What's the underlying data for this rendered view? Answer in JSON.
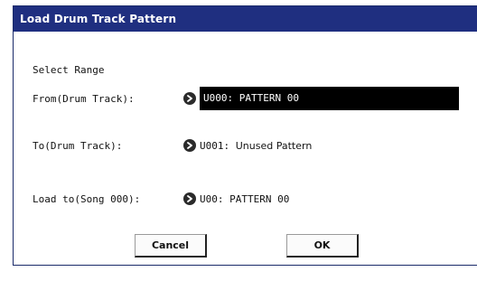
{
  "dialog": {
    "title": "Load Drum Track Pattern",
    "section_label": "Select Range",
    "from": {
      "label": "From(Drum Track):",
      "value": "U000: PATTERN 00",
      "arrow_icon": "right-arrow-icon"
    },
    "to": {
      "label": "To(Drum Track):",
      "value_code": "U001:",
      "value_name": "Unused Pattern",
      "arrow_icon": "right-arrow-icon"
    },
    "load_to": {
      "label": "Load to(Song 000):",
      "value": "U00: PATTERN 00",
      "arrow_icon": "right-arrow-icon"
    },
    "buttons": {
      "cancel": "Cancel",
      "ok": "OK"
    }
  },
  "colors": {
    "titlebar": "#1f2f80",
    "selected_field": "#000000"
  }
}
